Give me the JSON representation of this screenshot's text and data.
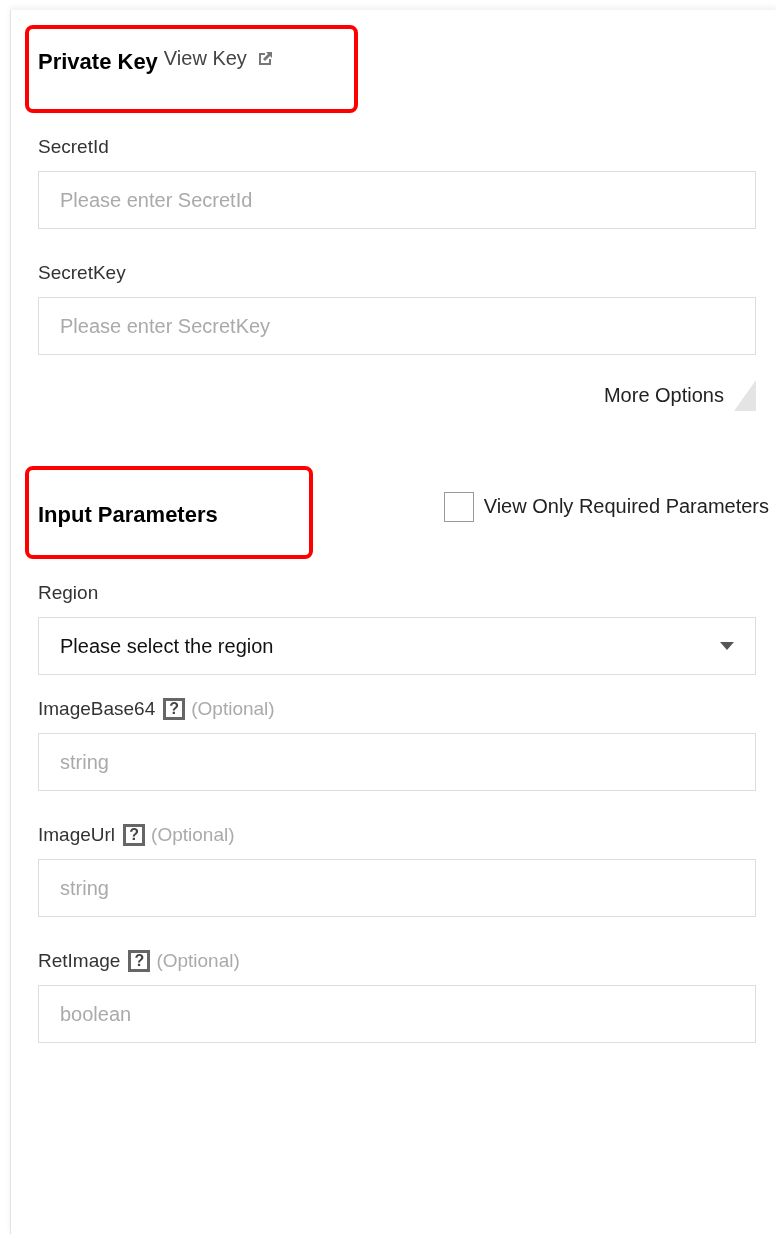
{
  "key_section": {
    "title": "Private Key",
    "highlighted": true,
    "link": "View Key"
  },
  "key_fields": [
    {
      "kind": "input",
      "label": "SecretId",
      "placeholder": "Please enter SecretId"
    },
    {
      "kind": "input",
      "label": "SecretKey",
      "placeholder": "Please enter SecretKey"
    }
  ],
  "more_options": "More Options",
  "params_section": {
    "title": "Input Parameters",
    "highlighted": true,
    "filter": {
      "label": "View Only Required Parameters",
      "checked": false
    }
  },
  "param_fields": [
    {
      "kind": "select",
      "label": "Region",
      "value": "Please select the region"
    },
    {
      "kind": "input",
      "label": "ImageBase64",
      "help_mark": "?",
      "note": "(Optional)",
      "placeholder": "string"
    },
    {
      "kind": "input",
      "label": "ImageUrl",
      "help_mark": "?",
      "note": "(Optional)",
      "placeholder": "string"
    },
    {
      "kind": "input",
      "label": "RetImage",
      "help_mark": "?",
      "note": "(Optional)",
      "placeholder": "boolean"
    }
  ]
}
